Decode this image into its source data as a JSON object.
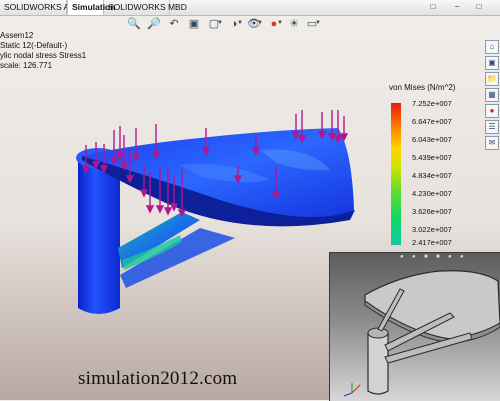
{
  "tabs": [
    {
      "label": "SOLIDWORKS Add-Ins",
      "active": false
    },
    {
      "label": "Simulation",
      "active": true
    },
    {
      "label": "SOLIDWORKS MBD",
      "active": false
    }
  ],
  "window_controls": {
    "restore": "□",
    "minimize": "−",
    "close": "□"
  },
  "toolbar": {
    "icons": [
      "magnify-icon",
      "zoom-area-icon",
      "previous-view-icon",
      "section-view-icon",
      "view-orientation-icon",
      "display-style-icon",
      "hide-show-icon",
      "edit-appearance-icon",
      "scene-icon",
      "view-settings-icon"
    ]
  },
  "study_info": {
    "line1": "Assem12",
    "line2": "Static 12(-Default-)",
    "line3": "ylic nodal stress Stress1",
    "line4": "scale: 126.771"
  },
  "legend": {
    "title": "von Mises (N/m^2)",
    "values": [
      "7.252e+007",
      "6.647e+007",
      "6.043e+007",
      "5.439e+007",
      "4.834e+007",
      "4.230e+007",
      "3.626e+007",
      "3.022e+007",
      "2.417e+007"
    ]
  },
  "watermark": "simulation2012.com",
  "colors": {
    "mesh_blue": "#1a3df0",
    "load_arrow": "#b0178f",
    "tab_active": "#ffffff"
  }
}
